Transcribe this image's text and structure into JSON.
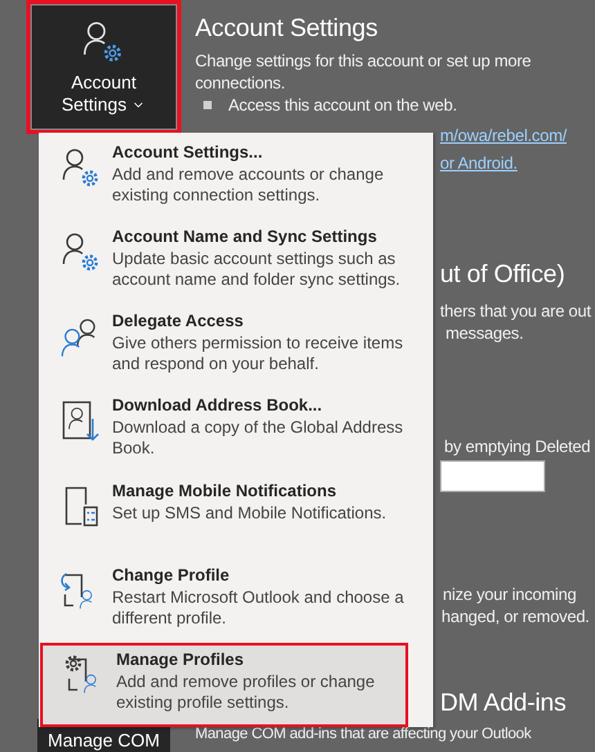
{
  "account_button": {
    "lines": [
      "Account",
      "Settings"
    ],
    "highlighted": true
  },
  "section": {
    "title": "Account Settings",
    "description": "Change settings for this account or set up more connections.",
    "bullets": [
      "Access this account on the web."
    ],
    "links": [
      "m/owa/rebel.com/",
      "or Android."
    ]
  },
  "auto_replies": {
    "heading": "ut of Office)",
    "lines": [
      "thers that you are out",
      "messages."
    ]
  },
  "cleanup": {
    "text": "by emptying Deleted"
  },
  "rules": {
    "lines": [
      "nize your incoming",
      "hanged, or removed."
    ]
  },
  "com_addins": {
    "heading": "DM Add-ins",
    "description": "Manage COM add-ins that are affecting your Outlook",
    "button": "Manage COM"
  },
  "menu": {
    "items": [
      {
        "kind": "account",
        "title": "Account Settings...",
        "description": "Add and remove accounts or change existing connection settings.",
        "selected": false
      },
      {
        "kind": "account",
        "title": "Account Name and Sync Settings",
        "description": "Update basic account settings such as account name and folder sync settings.",
        "selected": false
      },
      {
        "kind": "delegate",
        "title": "Delegate Access",
        "description": "Give others permission to receive items and respond on your behalf.",
        "selected": false
      },
      {
        "kind": "address-book",
        "title": "Download Address Book...",
        "description": "Download a copy of the Global Address Book.",
        "selected": false
      },
      {
        "kind": "mobile",
        "title": "Manage Mobile Notifications",
        "description": "Set up SMS and Mobile Notifications.",
        "selected": false
      },
      {
        "kind": "change-profile",
        "title": "Change Profile",
        "description": "Restart Microsoft Outlook and choose a different profile.",
        "selected": false
      },
      {
        "kind": "manage-profiles",
        "title": "Manage Profiles",
        "description": "Add and remove profiles or change existing profile settings.",
        "selected": true
      }
    ]
  }
}
